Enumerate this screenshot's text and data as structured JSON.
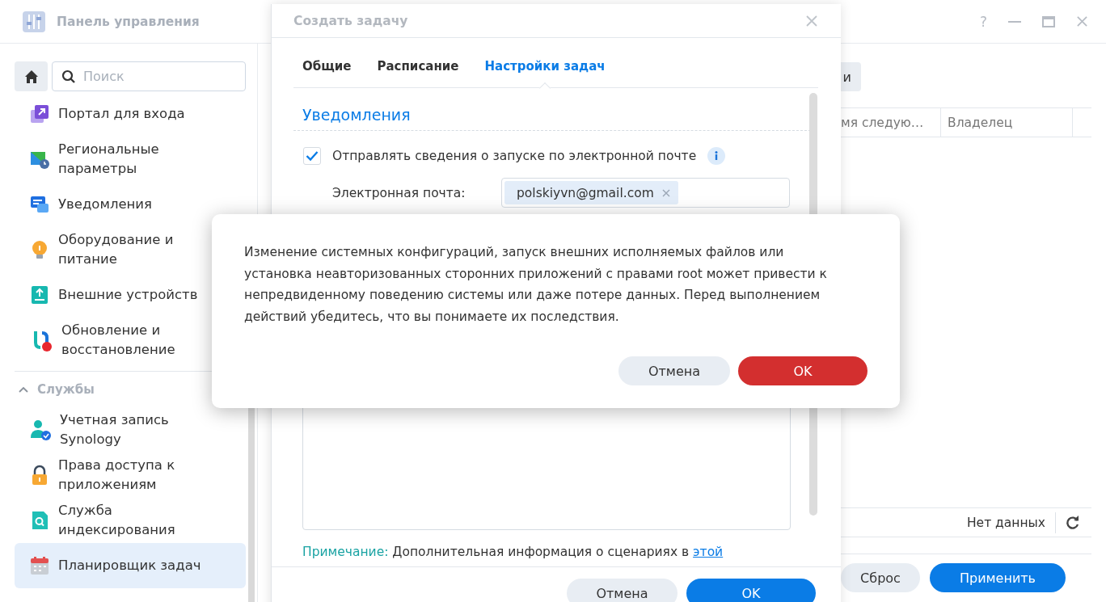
{
  "main_window": {
    "title": "Панель управления",
    "help_button": "?"
  },
  "sidebar": {
    "search": {
      "placeholder": "Поиск"
    },
    "items": [
      {
        "label": "Портал для входа",
        "selected": false
      },
      {
        "label": "Региональные параметры",
        "selected": false
      },
      {
        "label": "Уведомления",
        "selected": false
      },
      {
        "label": "Оборудование и питание",
        "selected": false
      },
      {
        "label": "Внешние устройств",
        "selected": false
      },
      {
        "label": "Обновление и восстановление",
        "selected": false
      }
    ],
    "groups": [
      {
        "title": "Службы",
        "expanded": true,
        "items": [
          {
            "label": "Учетная запись Synology",
            "selected": false
          },
          {
            "label": "Права доступа к приложениям",
            "selected": false
          },
          {
            "label": "Служба индексирования",
            "selected": false
          },
          {
            "label": "Планировщик задач",
            "selected": true
          }
        ]
      }
    ]
  },
  "content": {
    "toolbar_button": "и",
    "table": {
      "columns": [
        "мя следую…",
        "Владелец"
      ]
    },
    "status": "Нет данных",
    "buttons": [
      {
        "label": "Сброс",
        "kind": "secondary"
      },
      {
        "label": "Применить",
        "kind": "primary"
      }
    ]
  },
  "dialog": {
    "title": "Создать задачу",
    "tabs": [
      {
        "label": "Общие",
        "selected": false
      },
      {
        "label": "Расписание",
        "selected": false
      },
      {
        "label": "Настройки задач",
        "selected": true
      }
    ],
    "section": "Уведомления",
    "notify": {
      "label": "Отправлять сведения о запуске по электронной почте",
      "checked": true
    },
    "email": {
      "label": "Электронная почта:",
      "tokens": [
        "polskiyvn@gmail.com"
      ]
    },
    "note": {
      "label": "Примечание:",
      "text": "Дополнительная информация о сценариях в",
      "link": "этой"
    },
    "buttons": [
      {
        "label": "Отмена",
        "kind": "secondary"
      },
      {
        "label": "OK",
        "kind": "primary"
      }
    ]
  },
  "alert": {
    "text": "Изменение системных конфигураций, запуск внешних исполняемых файлов или установка неавторизованных сторонних приложений с правами root может привести к непредвиденному поведению системы или даже потере данных. Перед выполнением действий убедитесь, что вы понимаете их последствия.",
    "buttons": [
      {
        "label": "Отмена",
        "kind": "secondary"
      },
      {
        "label": "OK",
        "kind": "danger"
      }
    ]
  }
}
